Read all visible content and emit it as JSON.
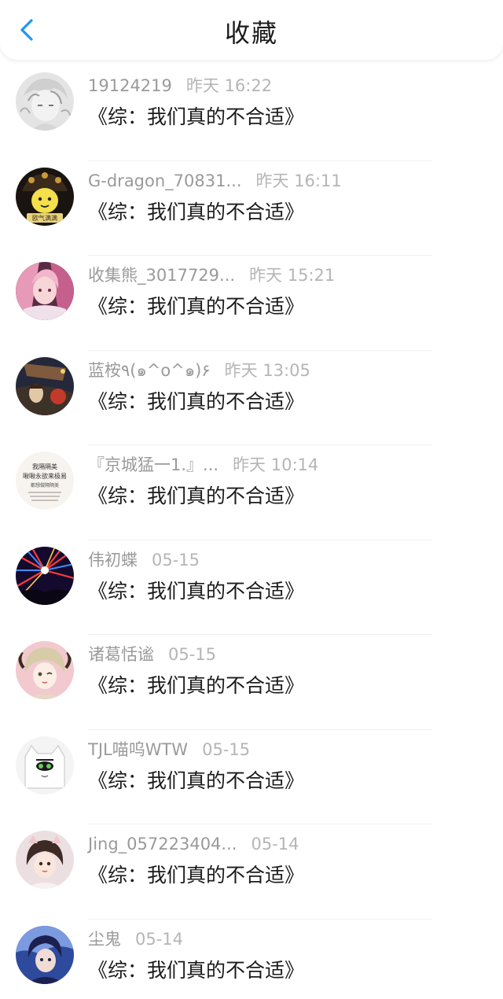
{
  "header": {
    "title": "收藏",
    "back_icon": "chevron-left-icon",
    "accent_color": "#2196f3"
  },
  "items": [
    {
      "user": "19124219",
      "time": "昨天 16:22",
      "book": "《综：我们真的不合适》"
    },
    {
      "user": "G-dragon_70831...",
      "time": "昨天 16:11",
      "book": "《综：我们真的不合适》"
    },
    {
      "user": "收集熊_3017729...",
      "time": "昨天 15:21",
      "book": "《综：我们真的不合适》"
    },
    {
      "user": "蓝桉٩(๑^o^๑)۶",
      "time": "昨天 13:05",
      "book": "《综：我们真的不合适》"
    },
    {
      "user": "『京城猛一1.』...",
      "time": "昨天 10:14",
      "book": "《综：我们真的不合适》"
    },
    {
      "user": "伟初蝶",
      "time": "05-15",
      "book": "《综：我们真的不合适》"
    },
    {
      "user": "诸葛恬谧",
      "time": "05-15",
      "book": "《综：我们真的不合适》"
    },
    {
      "user": "TJL喵呜WTW",
      "time": "05-15",
      "book": "《综：我们真的不合适》"
    },
    {
      "user": "Jing_057223404...",
      "time": "05-14",
      "book": "《综：我们真的不合适》"
    },
    {
      "user": "尘鬼",
      "time": "05-14",
      "book": "《综：我们真的不合适》"
    }
  ],
  "avatar_texts": {
    "item2": "欧气满满",
    "item5_line1": "我隔隔美",
    "item5_line2": "啾啾永欲来极易",
    "item5_line3": "都想做隔隔美"
  }
}
